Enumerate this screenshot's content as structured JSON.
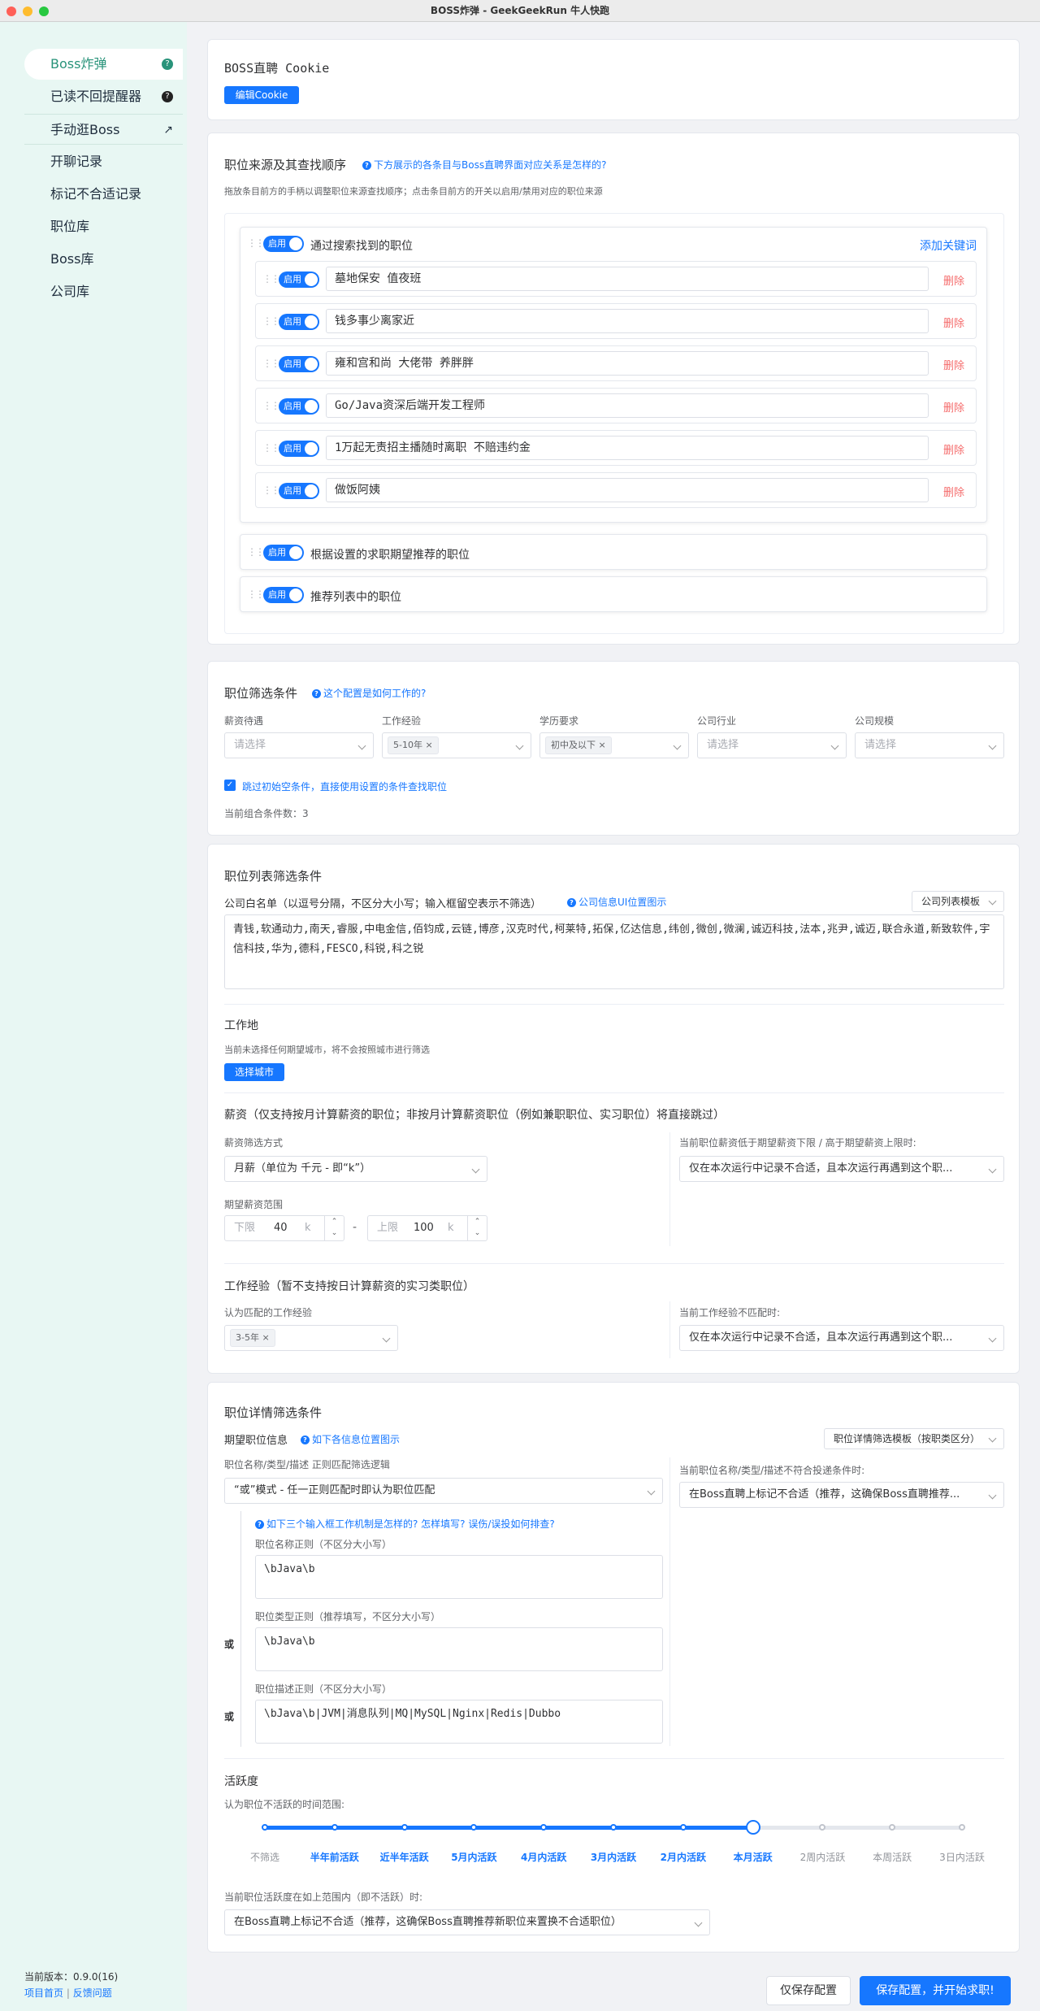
{
  "window_title": "BOSS炸弹 - GeekGeekRun 牛人快跑",
  "colors": {
    "accent": "#1677ff",
    "sidebar_bg": "#e8f7f3",
    "active_nav": "#29937a",
    "danger": "#f56c6c"
  },
  "sidebar": {
    "items": [
      {
        "label": "Boss炸弹",
        "badge": "?"
      },
      {
        "label": "已读不回提醒器",
        "badge": "?"
      },
      {
        "label": "手动逛Boss",
        "icon": "external-arrow-icon"
      },
      {
        "label": "开聊记录"
      },
      {
        "label": "标记不合适记录"
      },
      {
        "label": "职位库"
      },
      {
        "label": "Boss库"
      },
      {
        "label": "公司库"
      }
    ],
    "version": "当前版本：0.9.0(16)",
    "project_home": "项目首页",
    "separator": "|",
    "feedback": "反馈问题"
  },
  "cookie": {
    "title": "BOSS直聘 Cookie",
    "edit_btn": "编辑Cookie"
  },
  "source": {
    "title": "职位来源及其查找顺序",
    "help": "下方展示的各条目与Boss直聘界面对应关系是怎样的?",
    "desc": "拖放条目前方的手柄以调整职位来源查找顺序；点击条目前方的开关以启用/禁用对应的职位来源",
    "switch_label": "启用",
    "search_group": {
      "label": "通过搜索找到的职位",
      "add": "添加关键词"
    },
    "keywords": [
      "墓地保安  值夜班",
      "钱多事少离家近",
      "雍和宫和尚  大佬带  养胖胖",
      "Go/Java资深后端开发工程师",
      "1万起无责招主播随时离职  不赔违约金",
      "做饭阿姨"
    ],
    "delete": "删除",
    "expect_label": "根据设置的求职期望推荐的职位",
    "recommend_label": "推荐列表中的职位"
  },
  "filter": {
    "title": "职位筛选条件",
    "help": "这个配置是如何工作的?",
    "fields": [
      {
        "label": "薪资待遇",
        "placeholder": "请选择"
      },
      {
        "label": "工作经验",
        "tag": "5-10年"
      },
      {
        "label": "学历要求",
        "tag": "初中及以下"
      },
      {
        "label": "公司行业",
        "placeholder": "请选择"
      },
      {
        "label": "公司规模",
        "placeholder": "请选择"
      }
    ],
    "skip": "跳过初始空条件，直接使用设置的条件查找职位",
    "combo": "当前组合条件数：3"
  },
  "list": {
    "title": "职位列表筛选条件",
    "whitelist_label": "公司白名单（以逗号分隔，不区分大小写；输入框留空表示不筛选）",
    "whitelist_help": "公司信息UI位置图示",
    "template": "公司列表模板",
    "whitelist": "青钱,软通动力,南天,睿服,中电金信,佰钧成,云链,博彦,汉克时代,柯莱特,拓保,亿达信息,纬创,微创,微澜,诚迈科技,法本,兆尹,诚迈,联合永道,新致软件,宇信科技,华为,德科,FESCO,科锐,科之锐",
    "city_title": "工作地",
    "city_desc": "当前未选择任何期望城市，将不会按照城市进行筛选",
    "city_btn": "选择城市",
    "salary_title": "薪资（仅支持按月计算薪资的职位；非按月计算薪资职位（例如兼职职位、实习职位）将直接跳过）",
    "salary_mode_label": "薪资筛选方式",
    "salary_mode": "月薪（单位为 千元 - 即“k”）",
    "salary_range_label": "期望薪资范围",
    "lower_label": "下限",
    "lower": "40",
    "upper_label": "上限",
    "upper": "100",
    "unit": "k",
    "dash": "-",
    "salary_mismatch_label": "当前职位薪资低于期望薪资下限 / 高于期望薪资上限时:",
    "salary_mismatch": "仅在本次运行中记录不合适，且本次运行再遇到这个职...",
    "exp_title": "工作经验（暂不支持按日计算薪资的实习类职位）",
    "exp_label": "认为匹配的工作经验",
    "exp_tag": "3-5年",
    "exp_mismatch_label": "当前工作经验不匹配时:",
    "exp_mismatch": "仅在本次运行中记录不合适，且本次运行再遇到这个职..."
  },
  "detail": {
    "title": "职位详情筛选条件",
    "expect_label": "期望职位信息",
    "expect_help": "如下各信息位置图示",
    "template": "职位详情筛选模板（按职类区分）",
    "logic_label": "职位名称/类型/描述  正则匹配筛选逻辑",
    "logic": "“或”模式 - 任一正则匹配时即认为职位匹配",
    "mismatch_label": "当前职位名称/类型/描述不符合投递条件时:",
    "mismatch": "在Boss直聘上标记不合适（推荐，这确保Boss直聘推荐...",
    "regex_help": "如下三个输入框工作机制是怎样的? 怎样填写? 误伤/误投如何排查?",
    "name_label": "职位名称正则（不区分大小写）",
    "name_regex": "\\bJava\\b",
    "type_label": "职位类型正则（推荐填写，不区分大小写）",
    "type_regex": "\\bJava\\b",
    "desc_label": "职位描述正则（不区分大小写）",
    "desc_regex": "\\bJava\\b|JVM|消息队列|MQ|MySQL|Nginx|Redis|Dubbo",
    "or": "或"
  },
  "activity": {
    "title": "活跃度",
    "range_label": "认为职位不活跃的时间范围:",
    "levels": [
      "不筛选",
      "半年前活跃",
      "近半年活跃",
      "5月内活跃",
      "4月内活跃",
      "3月内活跃",
      "2月内活跃",
      "本月活跃",
      "2周内活跃",
      "本周活跃",
      "3日内活跃"
    ],
    "selected_index": 7,
    "action_label": "当前职位活跃度在如上范围内（即不活跃）时:",
    "action": "在Boss直聘上标记不合适（推荐，这确保Boss直聘推荐新职位来置换不合适职位）"
  },
  "footer": {
    "save_only": "仅保存配置",
    "save_start": "保存配置，并开始求职!"
  }
}
